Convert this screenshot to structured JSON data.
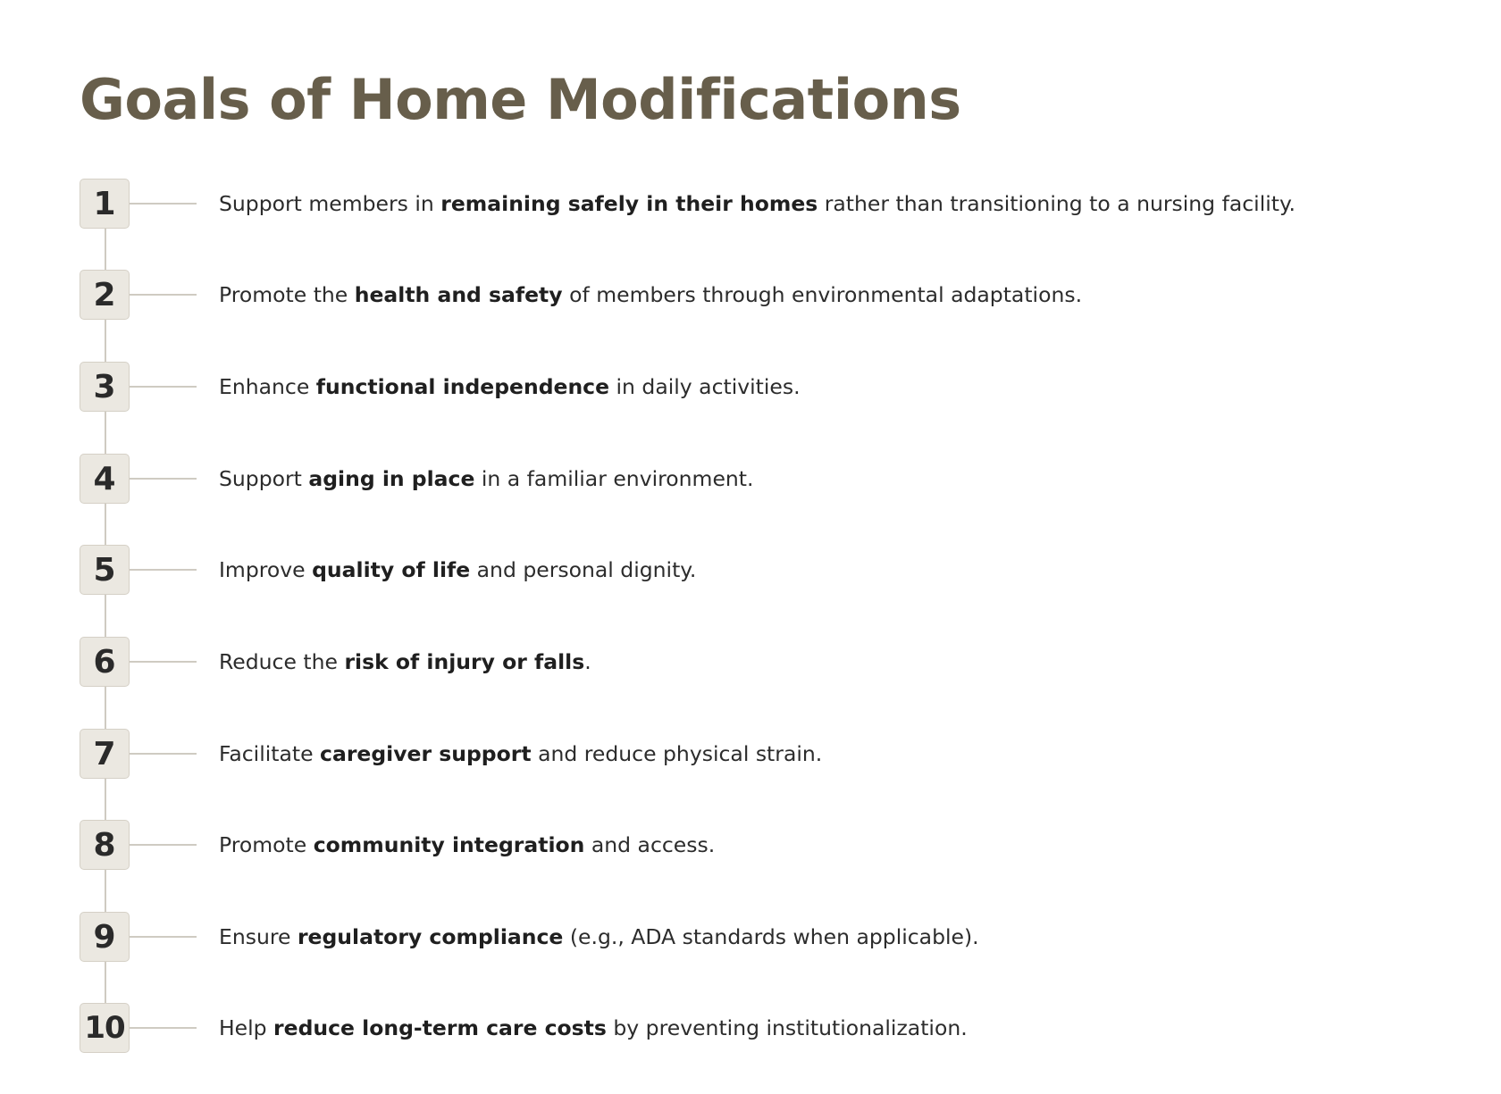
{
  "title": "Goals of Home Modifications",
  "colors": {
    "title": "#675e4b",
    "number_box_fill": "#ebe8e1",
    "number_box_border": "#d5d0c6",
    "connector_line": "#cfcbc2",
    "body_text": "#2c2c2c"
  },
  "goals": [
    {
      "number": "1",
      "before": "Support members in ",
      "bold": "remaining safely in their homes",
      "after": " rather than transitioning to a nursing facility."
    },
    {
      "number": "2",
      "before": "Promote the ",
      "bold": "health and safety",
      "after": " of members through environmental adaptations."
    },
    {
      "number": "3",
      "before": "Enhance ",
      "bold": "functional independence",
      "after": " in daily activities."
    },
    {
      "number": "4",
      "before": "Support ",
      "bold": "aging in place",
      "after": " in a familiar environment."
    },
    {
      "number": "5",
      "before": "Improve ",
      "bold": "quality of life",
      "after": " and personal dignity."
    },
    {
      "number": "6",
      "before": "Reduce the ",
      "bold": "risk of injury or falls",
      "after": "."
    },
    {
      "number": "7",
      "before": "Facilitate ",
      "bold": "caregiver support",
      "after": " and reduce physical strain."
    },
    {
      "number": "8",
      "before": "Promote ",
      "bold": "community integration",
      "after": " and access."
    },
    {
      "number": "9",
      "before": "Ensure ",
      "bold": "regulatory compliance",
      "after": " (e.g., ADA standards when applicable)."
    },
    {
      "number": "10",
      "before": "Help ",
      "bold": "reduce long-term care costs",
      "after": " by preventing institutionalization."
    }
  ]
}
